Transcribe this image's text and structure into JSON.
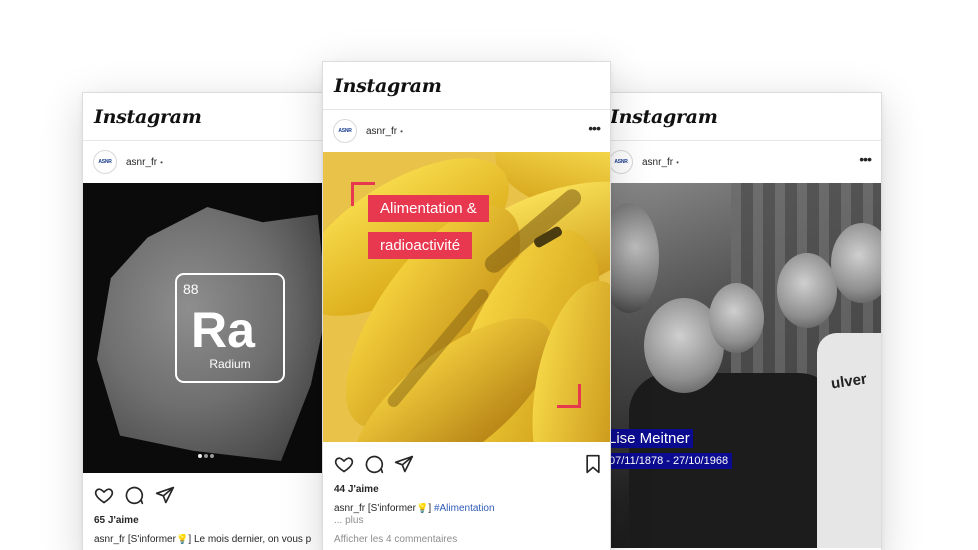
{
  "brand": "Instagram",
  "colors": {
    "accent_red": "#e8384f",
    "caption_blue": "#0b0b90",
    "hashtag": "#2f5bb7"
  },
  "posts": {
    "left": {
      "username": "asnr_fr",
      "dot": "•",
      "avatar_text": "ASNR",
      "element": {
        "number": "88",
        "symbol": "Ra",
        "name": "Radium"
      },
      "likes": "65 J'aime",
      "caption_user": "asnr_fr",
      "caption": "[S'informer💡] Le mois dernier, on vous p"
    },
    "center": {
      "username": "asnr_fr",
      "dot": "•",
      "avatar_text": "ASNR",
      "more": "•••",
      "tag_line1": "Alimentation &",
      "tag_line2": "radioactivité",
      "likes": "44 J'aime",
      "caption_user": "asnr_fr",
      "caption": "[S'informer💡] ",
      "hashtag": "#Alimentation",
      "more_label": "... plus",
      "comments": "Afficher les 4 commentaires"
    },
    "right": {
      "username": "asnr_fr",
      "dot": "•",
      "avatar_text": "ASNR",
      "more": "•••",
      "person_name": "Lise Meitner",
      "dates": "07/11/1878 - 27/10/1968",
      "sweater_text": "ulver"
    }
  },
  "icons": [
    "heart-icon",
    "comment-icon",
    "share-icon",
    "bookmark-icon",
    "more-icon"
  ]
}
